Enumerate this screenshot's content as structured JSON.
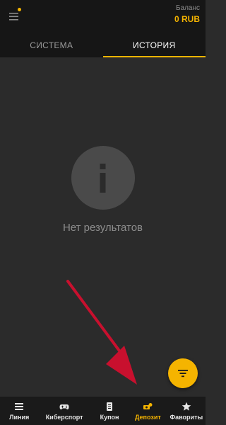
{
  "header": {
    "menu_icon": "menu-icon",
    "balance_caption": "Баланс",
    "balance_value": "0 RUB",
    "accent_color": "#f5b400"
  },
  "tabs": [
    {
      "label": "СИСТЕМА",
      "active": false
    },
    {
      "label": "ИСТОРИЯ",
      "active": true
    }
  ],
  "empty_state": {
    "icon": "info-icon",
    "text": "Нет результатов"
  },
  "fab": {
    "icon": "filter-icon"
  },
  "annotation": {
    "type": "arrow",
    "color": "#c8102e"
  },
  "bottom_nav": {
    "items": [
      {
        "label": "Линия",
        "icon": "list-icon",
        "active": false
      },
      {
        "label": "Киберспорт",
        "icon": "gamepad-icon",
        "active": false
      },
      {
        "label": "Купон",
        "icon": "coupon-icon",
        "active": false
      },
      {
        "label": "Депозит",
        "icon": "deposit-icon",
        "active": true
      },
      {
        "label": "Фавориты",
        "icon": "star-icon",
        "active": false
      }
    ]
  }
}
